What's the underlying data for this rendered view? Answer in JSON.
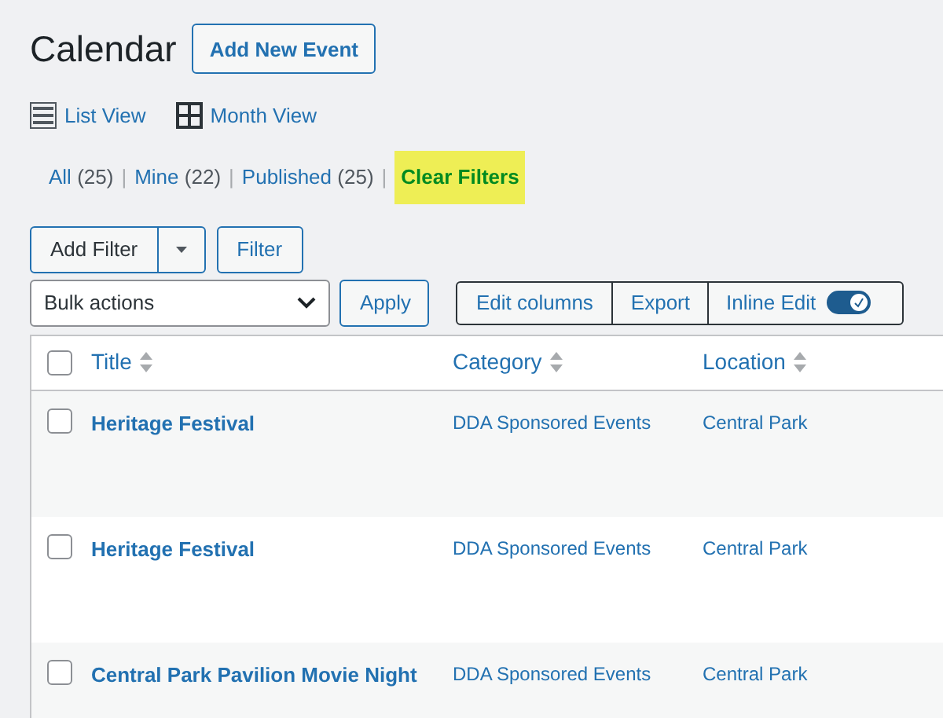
{
  "page": {
    "title": "Calendar",
    "add_button": "Add New Event"
  },
  "views": [
    {
      "label": "List View",
      "kind": "list"
    },
    {
      "label": "Month View",
      "kind": "month"
    }
  ],
  "filters": [
    {
      "label": "All",
      "count": "(25)",
      "kind": "link"
    },
    {
      "separator": "|",
      "label": "Mine",
      "count": "(22)",
      "kind": "link"
    },
    {
      "separator": "|",
      "label": "Published",
      "count": "(25)",
      "kind": "link"
    },
    {
      "separator": "|",
      "label": "Clear Filters",
      "kind": "clear"
    }
  ],
  "filter_bar": {
    "add_filter": "Add Filter",
    "filter": "Filter"
  },
  "bulk": {
    "value": "Bulk actions",
    "apply": "Apply"
  },
  "tools": {
    "edit_columns": "Edit columns",
    "export": "Export",
    "inline_edit": "Inline Edit",
    "inline_on": true
  },
  "table": {
    "select_all_checked": false,
    "columns": [
      "Title",
      "Category",
      "Location"
    ],
    "rows": [
      {
        "checked": false,
        "title": "Heritage Festival",
        "category": "DDA Sponsored Events",
        "location": "Central Park"
      },
      {
        "checked": false,
        "title": "Heritage Festival",
        "category": "DDA Sponsored Events",
        "location": "Central Park"
      },
      {
        "checked": false,
        "title": "Central Park Pavilion Movie Night",
        "category": "DDA Sponsored Events",
        "location": "Central Park"
      }
    ]
  }
}
